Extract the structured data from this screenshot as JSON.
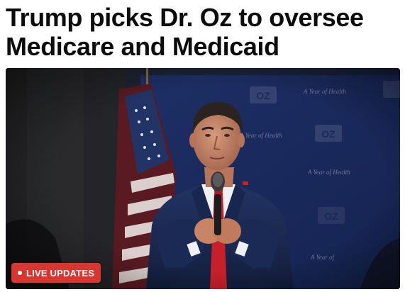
{
  "article": {
    "headline": "Trump picks Dr. Oz to oversee Medicare and Medicaid",
    "badge_label": "LIVE UPDATES",
    "badge_color": "#d9362f"
  },
  "photo": {
    "banner_logo_text": "OZ",
    "banner_tagline": "A Year of Health",
    "icons": [
      "live-dot-icon"
    ]
  }
}
